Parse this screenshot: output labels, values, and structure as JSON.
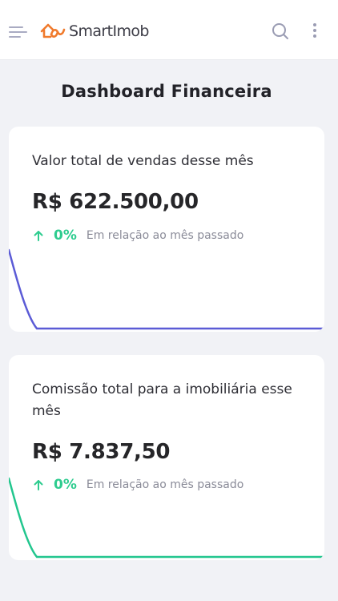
{
  "header": {
    "brand_name": "SmartImob",
    "brand_color": "#f07a2c",
    "icons": [
      "menu-icon",
      "smartimob-logo-icon",
      "search-icon",
      "more-vertical-icon"
    ]
  },
  "page": {
    "title": "Dashboard Financeira"
  },
  "cards": [
    {
      "label": "Valor total de vendas desse mês",
      "value": "R$ 622.500,00",
      "change": "0%",
      "change_direction": "up",
      "change_note": "Em relação ao mês passado",
      "line_color": "#5b5bd6"
    },
    {
      "label": "Comissão total para a imobiliária esse mês",
      "value": "R$ 7.837,50",
      "change": "0%",
      "change_direction": "up",
      "change_note": "Em relação ao mês passado",
      "line_color": "#22c68e"
    }
  ],
  "colors": {
    "positive": "#2ecc8f",
    "background": "#f1f2f6",
    "card": "#ffffff"
  }
}
